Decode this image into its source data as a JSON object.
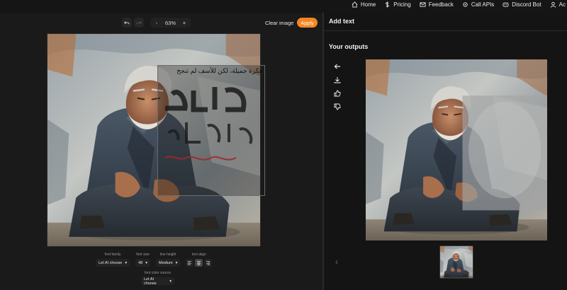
{
  "nav": {
    "items": [
      {
        "label": "Home",
        "icon": "home-icon"
      },
      {
        "label": "Pricing",
        "icon": "dollar-icon"
      },
      {
        "label": "Feedback",
        "icon": "mail-icon"
      },
      {
        "label": "Call APIs",
        "icon": "gear-icon"
      },
      {
        "label": "Discord Bot",
        "icon": "discord-icon"
      },
      {
        "label": "Ac",
        "icon": "user-icon"
      }
    ]
  },
  "toolbar": {
    "undo_icon": "undo-icon",
    "redo_icon": "redo-icon",
    "zoom_out": "-",
    "zoom_value": "63%",
    "zoom_in": "+",
    "clear_label": "Clear image",
    "apply_label": "Apply"
  },
  "overlay": {
    "text": "فكرة جميلة، لكن للأسف لم تنجح"
  },
  "controls": {
    "font_family": {
      "label": "font family",
      "value": "Let AI choose"
    },
    "font_size": {
      "label": "font size",
      "value": "48"
    },
    "line_height": {
      "label": "line height",
      "value": "Medium"
    },
    "text_align": {
      "label": "text align",
      "options": [
        "left",
        "center",
        "right"
      ],
      "selected": "center"
    },
    "font_color_source": {
      "label": "font color source",
      "value": "Let AI choose"
    }
  },
  "right_panel": {
    "header": "Add text",
    "outputs_title": "Your outputs",
    "side_icons": [
      "arrow-left-icon",
      "download-icon",
      "thumbs-up-icon",
      "thumbs-down-icon"
    ]
  },
  "colors": {
    "accent": "#f5861f",
    "panel": "#1a1a1a",
    "background": "#141414"
  }
}
